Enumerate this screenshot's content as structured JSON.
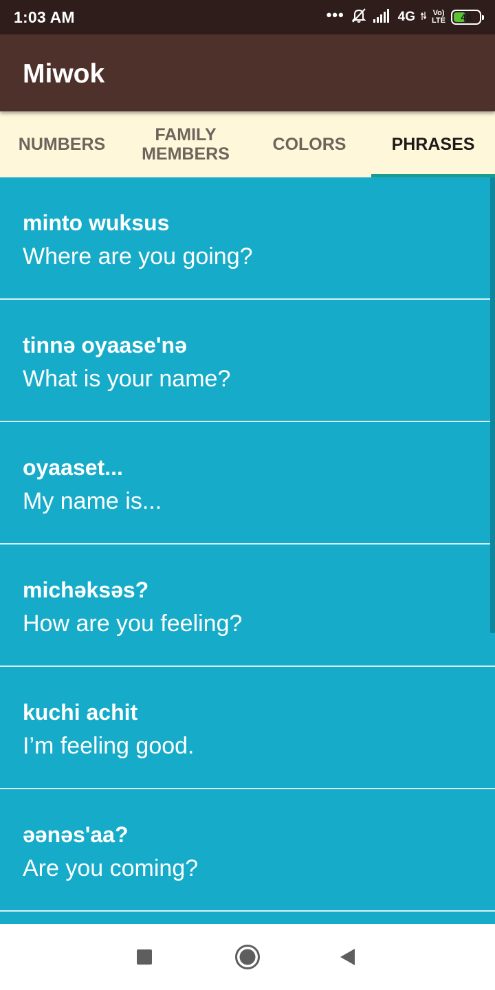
{
  "status_bar": {
    "time": "1:03 AM",
    "dots": "•••",
    "network": "4G",
    "volte_top": "Vo)",
    "volte_bottom": "LTE",
    "battery": "46",
    "battery_level": 0.46,
    "battery_color": "#5BC236",
    "icons": [
      "alarm-off-icon",
      "signal-icon",
      "data-arrows-icon",
      "battery-icon"
    ]
  },
  "app_bar": {
    "title": "Miwok",
    "color": "#4E312B"
  },
  "tabs": [
    {
      "label": "NUMBERS",
      "active": false
    },
    {
      "label": "FAMILY MEMBERS",
      "active": false
    },
    {
      "label": "COLORS",
      "active": false
    },
    {
      "label": "PHRASES",
      "active": true
    }
  ],
  "list": {
    "background": "#16ACC9",
    "items": [
      {
        "miwok": "minto wuksus",
        "english": "Where are you going?"
      },
      {
        "miwok": "tinnə oyaase'nə",
        "english": "What is your name?"
      },
      {
        "miwok": "oyaaset...",
        "english": "My name is..."
      },
      {
        "miwok": "michəksəs?",
        "english": "How are you feeling?"
      },
      {
        "miwok": "kuchi achit",
        "english": "I’m feeling good."
      },
      {
        "miwok": "əənəs'aa?",
        "english": "Are you coming?"
      }
    ]
  },
  "nav_bar": {
    "buttons": [
      "recents-square-icon",
      "home-circle-icon",
      "back-triangle-icon"
    ]
  }
}
